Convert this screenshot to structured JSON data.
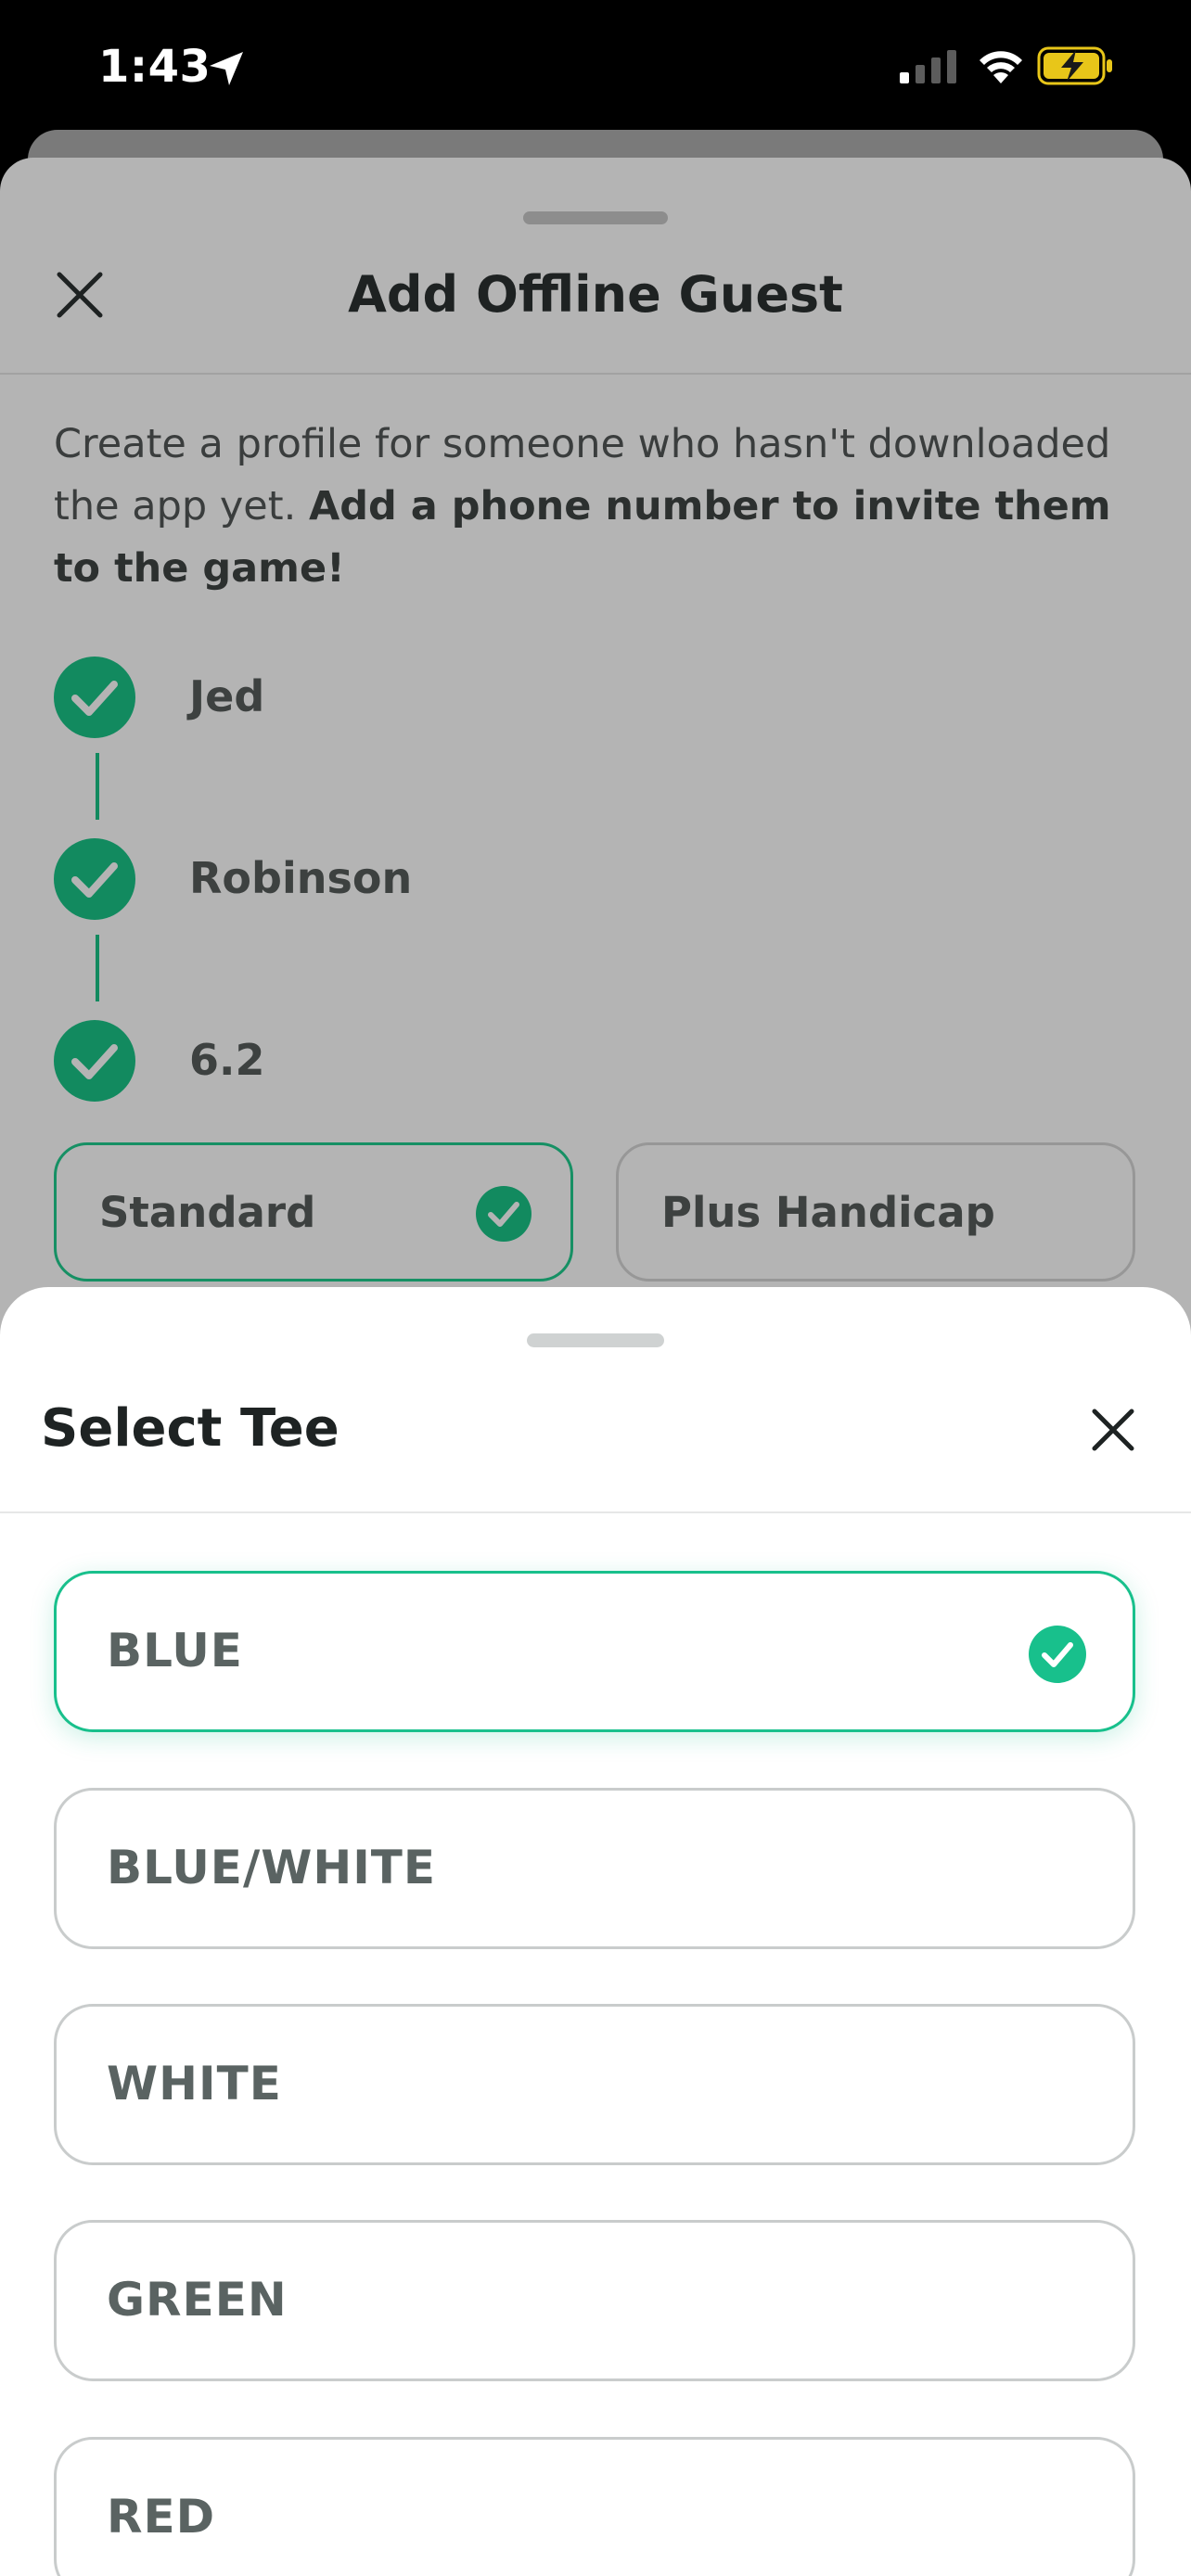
{
  "status_bar": {
    "time": "1:43"
  },
  "main": {
    "title": "Add Offline Guest",
    "description_plain": "Create a profile for someone who hasn't downloaded the app yet. ",
    "description_bold": "Add a phone number to invite them to the game!",
    "steps": [
      {
        "label": "Jed"
      },
      {
        "label": "Robinson"
      },
      {
        "label": "6.2"
      }
    ],
    "handicap_options": [
      {
        "label": "Standard",
        "selected": true
      },
      {
        "label": "Plus Handicap",
        "selected": false
      }
    ]
  },
  "tee_sheet": {
    "title": "Select Tee",
    "options": [
      {
        "label": "BLUE",
        "selected": true
      },
      {
        "label": "BLUE/WHITE",
        "selected": false
      },
      {
        "label": "WHITE",
        "selected": false
      },
      {
        "label": "GREEN",
        "selected": false
      },
      {
        "label": "RED",
        "selected": false
      }
    ]
  },
  "colors": {
    "accent_green": "#18c08c",
    "dimmed_green": "#169064",
    "overlay_gray": "#b4b4b4"
  }
}
